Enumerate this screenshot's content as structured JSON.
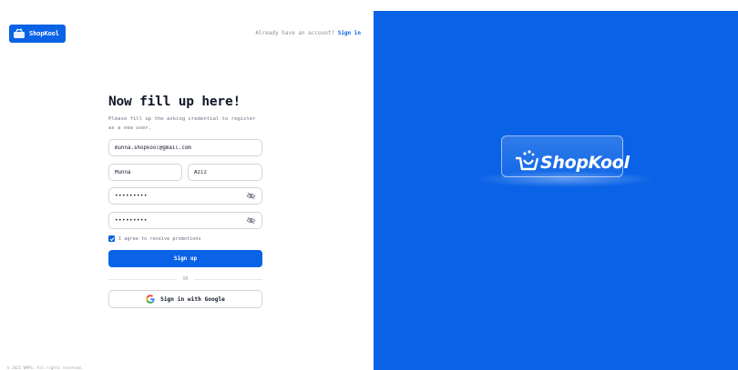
{
  "brand": {
    "name": "ShopKool",
    "hero_name": "ShopKool",
    "color": "#0a63e6"
  },
  "header": {
    "prompt": "Already have an account?",
    "signin_label": "Sign in"
  },
  "form": {
    "title": "Now fill up here!",
    "subtitle": "Please fill up the asking credential to register as a new user.",
    "email": {
      "value": "munna.shopkool@gmail.com"
    },
    "first_name": {
      "value": "Munna"
    },
    "last_name": {
      "value": "Aziz"
    },
    "password": {
      "value": "•••••••••",
      "icon": "eye-off-icon"
    },
    "confirm_password": {
      "value": "•••••••••",
      "icon": "eye-off-icon"
    },
    "promotions": {
      "label": "I agree to receive promotions",
      "checked": true
    },
    "signup_label": "Sign up",
    "divider_label": "OR",
    "google_label": "Sign in with Google",
    "google_icon": "google-icon"
  },
  "footer": {
    "text": "© 2022 WMPS. All rights reserved."
  }
}
